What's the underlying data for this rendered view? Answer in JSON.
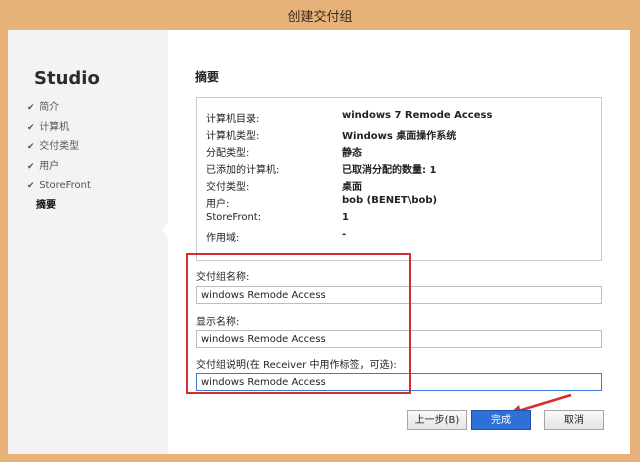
{
  "window": {
    "title": "创建交付组"
  },
  "sidebar": {
    "brand": "Studio",
    "items": [
      {
        "label": "简介",
        "check": "✔"
      },
      {
        "label": "计算机",
        "check": "✔"
      },
      {
        "label": "交付类型",
        "check": "✔"
      },
      {
        "label": "用户",
        "check": "✔"
      },
      {
        "label": "StoreFront",
        "check": "✔"
      },
      {
        "label": "摘要",
        "check": ""
      }
    ]
  },
  "main": {
    "heading": "摘要",
    "summary": [
      {
        "label": "计算机目录:",
        "value": "windows 7 Remode Access"
      },
      {
        "label": "计算机类型:",
        "value": "Windows 桌面操作系统"
      },
      {
        "label": "分配类型:",
        "value": "静态"
      },
      {
        "label": "已添加的计算机:",
        "value": "已取消分配的数量: 1"
      },
      {
        "label": "交付类型:",
        "value": "桌面"
      },
      {
        "label": "用户:",
        "value": "bob (BENET\\bob)"
      },
      {
        "label": "StoreFront:",
        "value": "1"
      },
      {
        "label": "作用域:",
        "value": "-"
      }
    ],
    "fields": [
      {
        "label": "交付组名称:",
        "value": "windows Remode Access"
      },
      {
        "label": "显示名称:",
        "value": "windows Remode Access"
      },
      {
        "label": "交付组说明(在 Receiver 中用作标签，可选):",
        "value": "windows Remode Access"
      }
    ]
  },
  "buttons": {
    "back": "上一步(B)",
    "finish": "完成",
    "cancel": "取消"
  },
  "colors": {
    "title_bar": "#e7b27a",
    "highlight": "#d52d2d",
    "primary": "#2f6fd8"
  }
}
